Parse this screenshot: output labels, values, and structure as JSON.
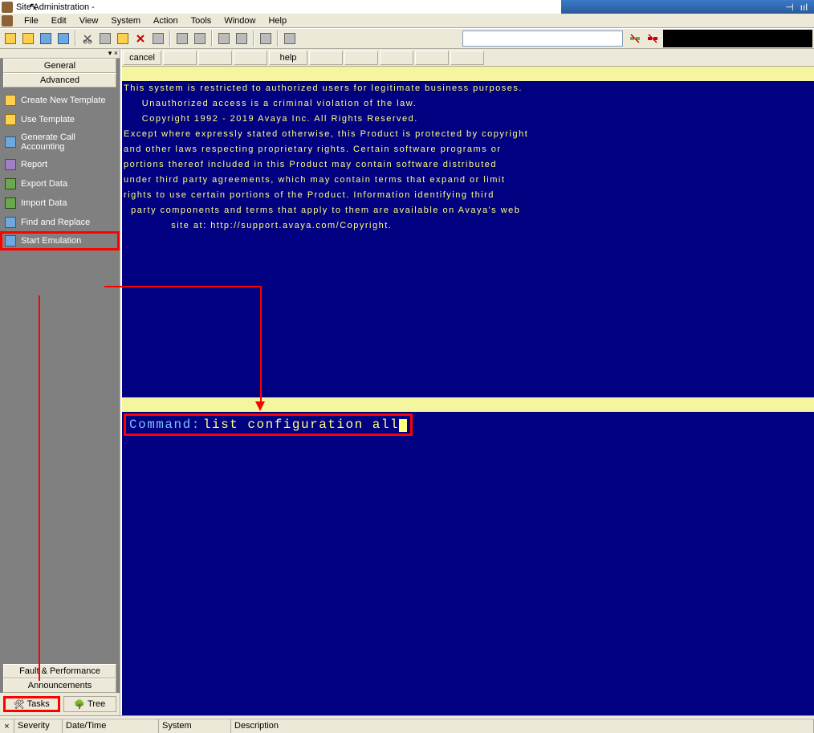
{
  "titlebar": {
    "title": "Site Administration -"
  },
  "menu": {
    "file": "File",
    "edit": "Edit",
    "view": "View",
    "system": "System",
    "action": "Action",
    "tools": "Tools",
    "window": "Window",
    "help": "Help"
  },
  "sidebar": {
    "general": "General",
    "advanced": "Advanced",
    "items": [
      {
        "label": "Create New Template"
      },
      {
        "label": "Use Template"
      },
      {
        "label": "Generate Call Accounting"
      },
      {
        "label": "Report"
      },
      {
        "label": "Export Data"
      },
      {
        "label": "Import Data"
      },
      {
        "label": "Find and Replace"
      },
      {
        "label": "Start Emulation"
      }
    ],
    "fault_perf": "Fault & Performance",
    "announcements": "Announcements",
    "tab_tasks": "Tasks",
    "tab_tree": "Tree"
  },
  "content_toolbar": {
    "cancel": "cancel",
    "help": "help"
  },
  "terminal": {
    "l1": "This system is restricted to authorized users for legitimate business purposes.",
    "l2": "     Unauthorized access is a criminal violation of the law.",
    "l3": "     Copyright 1992 - 2019 Avaya Inc. All Rights Reserved.",
    "l4": "Except where expressly stated otherwise, this Product is protected by copyright",
    "l5": "and other laws respecting proprietary rights. Certain software programs or",
    "l6": "portions thereof included in this Product may contain software distributed",
    "l7": "under third party agreements, which may contain terms that expand or limit",
    "l8": "rights to use certain portions of the Product. Information identifying third",
    "l9": "  party components and terms that apply to them are available on Avaya's web",
    "l10": "             site at: http://support.avaya.com/Copyright.",
    "cmd_label": "Command:",
    "cmd_value": "list configuration all"
  },
  "status": {
    "severity": "Severity",
    "datetime": "Date/Time",
    "system": "System",
    "description": "Description"
  }
}
